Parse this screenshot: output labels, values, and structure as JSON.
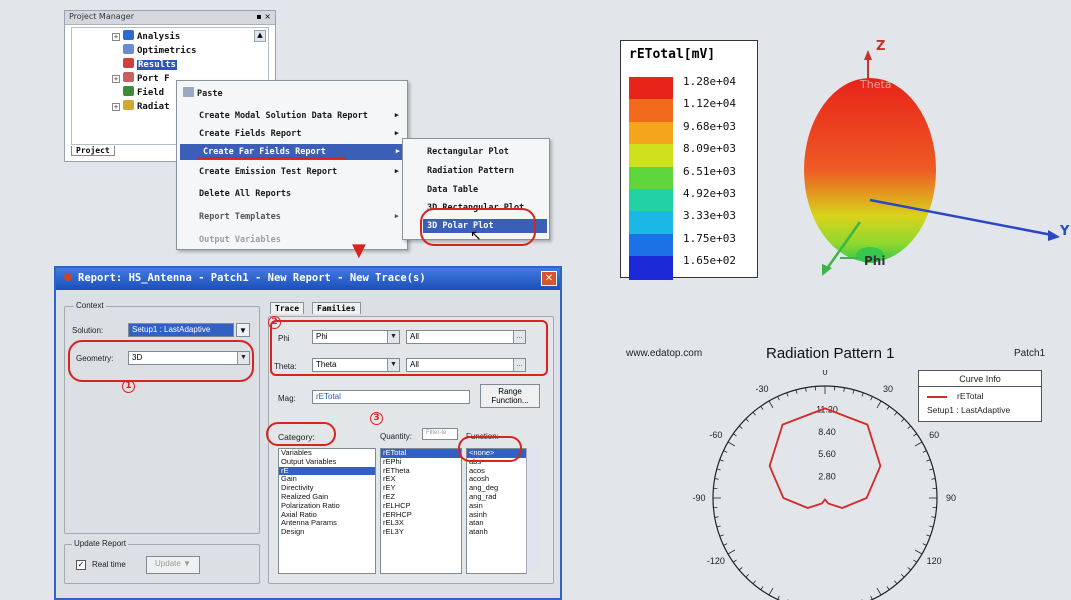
{
  "project_manager": {
    "title": "Project Manager",
    "items": [
      {
        "label": "Analysis",
        "icon": "analysis-icon"
      },
      {
        "label": "Optimetrics",
        "icon": "optimetrics-icon"
      },
      {
        "label": "Results",
        "icon": "results-icon"
      },
      {
        "label": "Port F",
        "icon": "port-field-icon"
      },
      {
        "label": "Field",
        "icon": "field-icon"
      },
      {
        "label": "Radiat",
        "icon": "radiation-icon"
      }
    ],
    "tab": "Project"
  },
  "context_menu": {
    "paste": "Paste",
    "items": [
      "Create Modal Solution Data Report",
      "Create Fields Report",
      "Create Far Fields Report",
      "Create Emission Test Report",
      "Delete All Reports",
      "Report Templates",
      "Output Variables"
    ]
  },
  "submenu": {
    "items": [
      "Rectangular Plot",
      "Radiation Pattern",
      "Data Table",
      "3D Rectangular Plot",
      "3D Polar Plot"
    ]
  },
  "dialog": {
    "title": "Report: HS_Antenna - Patch1 - New Report - New Trace(s)",
    "context_label": "Context",
    "solution_label": "Solution:",
    "solution_value": "Setup1 : LastAdaptive",
    "geometry_label": "Geometry:",
    "geometry_value": "3D",
    "tabs": [
      "Trace",
      "Families"
    ],
    "phi_label": "Phi",
    "phi_value": "Phi",
    "phi_range": "All",
    "theta_label": "Theta:",
    "theta_value": "Theta",
    "theta_range": "All",
    "mag_label": "Mag:",
    "mag_value": "rETotal",
    "range_function": "Range Function...",
    "category_label": "Category:",
    "quantity_label": "Quantity:",
    "quantity_filter": "Filter-te",
    "function_label": "Function:",
    "categories": [
      "Variables",
      "Output Variables",
      "rE",
      "Gain",
      "Directivity",
      "Realized Gain",
      "Polarization Ratio",
      "Axial Ratio",
      "Antenna Params",
      "Design"
    ],
    "quantities": [
      "rETotal",
      "rEPhi",
      "rETheta",
      "rEX",
      "rEY",
      "rEZ",
      "rELHCP",
      "rERHCP",
      "rEL3X",
      "rEL3Y"
    ],
    "functions": [
      "<none>",
      "abs",
      "acos",
      "acosh",
      "ang_deg",
      "ang_rad",
      "asin",
      "asinh",
      "atan",
      "atanh"
    ],
    "update_group": "Update Report",
    "realtime": "Real time",
    "update_btn": "Update",
    "annotations": [
      "1",
      "2",
      "3"
    ]
  },
  "legend3d": {
    "title": "rETotal[mV]",
    "values": [
      "1.28e+04",
      "1.12e+04",
      "9.68e+03",
      "8.09e+03",
      "6.51e+03",
      "4.92e+03",
      "3.33e+03",
      "1.75e+03",
      "1.65e+02"
    ],
    "colors": [
      "#e8231a",
      "#f26a1c",
      "#f4a51a",
      "#cfe11c",
      "#5fd63c",
      "#22d2a4",
      "#1bb8e6",
      "#1c71e6",
      "#1b2ad6"
    ]
  },
  "axes3d": {
    "z": "Z",
    "y": "Y",
    "x": "Phi",
    "theta": "Theta"
  },
  "polar": {
    "site": "www.edatop.com",
    "title": "Radiation Pattern 1",
    "design": "Patch1",
    "angles": [
      "0",
      "30",
      "-30",
      "60",
      "-60",
      "90",
      "-90",
      "120",
      "-120"
    ],
    "radial": [
      "11.20",
      "8.40",
      "5.60",
      "2.80"
    ],
    "curve_info": "Curve Info",
    "trace": "rETotal",
    "setup": "Setup1 : LastAdaptive",
    "line_color": "#d42a2a"
  },
  "chart_data": {
    "type": "line",
    "title": "Radiation Pattern 1",
    "radial_ticks": [
      2.8,
      5.6,
      8.4,
      11.2
    ],
    "angle_ticks": [
      0,
      30,
      60,
      90,
      120,
      -30,
      -60,
      -90,
      -120
    ],
    "series": [
      {
        "name": "rETotal",
        "theta_deg": [
          -90,
          -60,
          -30,
          0,
          30,
          60,
          90,
          120,
          150,
          180
        ],
        "values": [
          5.2,
          8.0,
          10.6,
          11.2,
          10.6,
          8.0,
          5.2,
          2.5,
          0.8,
          0.2
        ]
      }
    ]
  }
}
